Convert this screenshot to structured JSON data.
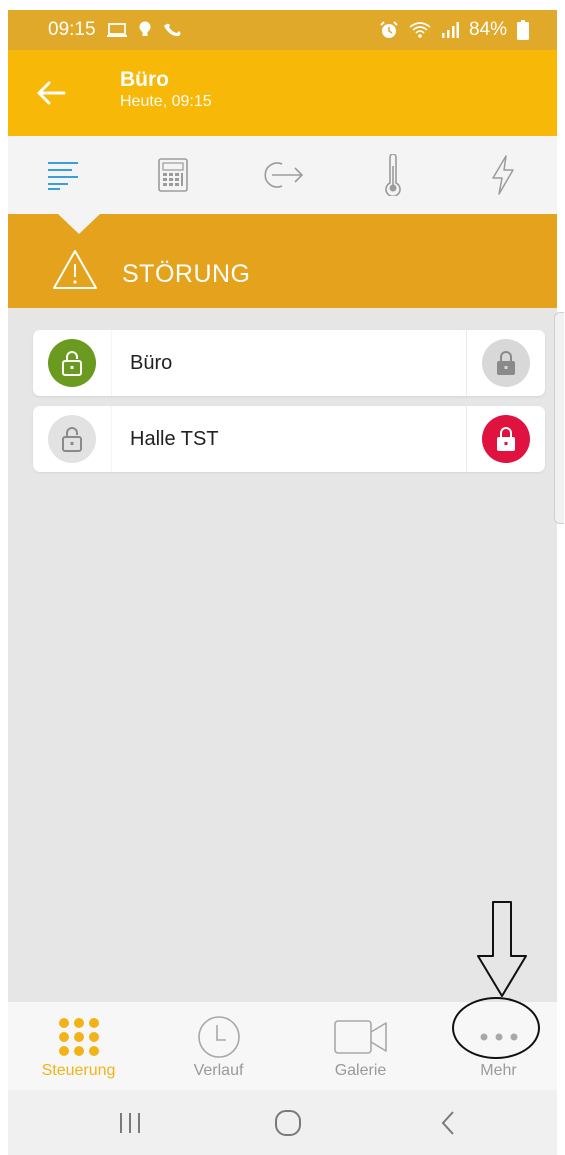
{
  "statusbar": {
    "time": "09:15",
    "battery": "84%",
    "icons": [
      "laptop-icon",
      "bulb-icon",
      "phone-icon",
      "alarm-icon",
      "wifi-icon",
      "signal-icon",
      "battery-icon"
    ]
  },
  "appbar": {
    "title": "Büro",
    "subtitle": "Heute, 09:15",
    "back_icon": "arrow-left-icon"
  },
  "tabs": [
    {
      "icon": "list-lines-icon",
      "active": true
    },
    {
      "icon": "keypad-icon",
      "active": false
    },
    {
      "icon": "exit-icon",
      "active": false
    },
    {
      "icon": "thermometer-icon",
      "active": false
    },
    {
      "icon": "lightning-icon",
      "active": false
    }
  ],
  "alert": {
    "icon": "warning-triangle-icon",
    "text": "STÖRUNG"
  },
  "locks": [
    {
      "label": "Büro",
      "left_state": "unlocked",
      "left_color": "#6a9a1f",
      "right_state": "locked",
      "right_color": "#d8d8d8"
    },
    {
      "label": "Halle TST",
      "left_state": "unlocked",
      "left_color": "#e2e2e2",
      "right_state": "locked",
      "right_color": "#e0123f"
    }
  ],
  "bottomnav": [
    {
      "label": "Steuerung",
      "icon": "grid-dots-icon",
      "active": true
    },
    {
      "label": "Verlauf",
      "icon": "clock-icon",
      "active": false
    },
    {
      "label": "Galerie",
      "icon": "video-camera-icon",
      "active": false
    },
    {
      "label": "Mehr",
      "icon": "more-dots-icon",
      "active": false
    }
  ],
  "sysnav": {
    "icons": [
      "recent-apps-icon",
      "home-icon",
      "back-chevron-icon"
    ]
  },
  "colors": {
    "accent": "#f7b808",
    "alert": "#e5a21c",
    "status_bar": "#e0a92a",
    "tab_active": "#3a9fd6",
    "nav_active": "#f2b318",
    "lock_open_green": "#6a9a1f",
    "lock_closed_red": "#e0123f"
  }
}
